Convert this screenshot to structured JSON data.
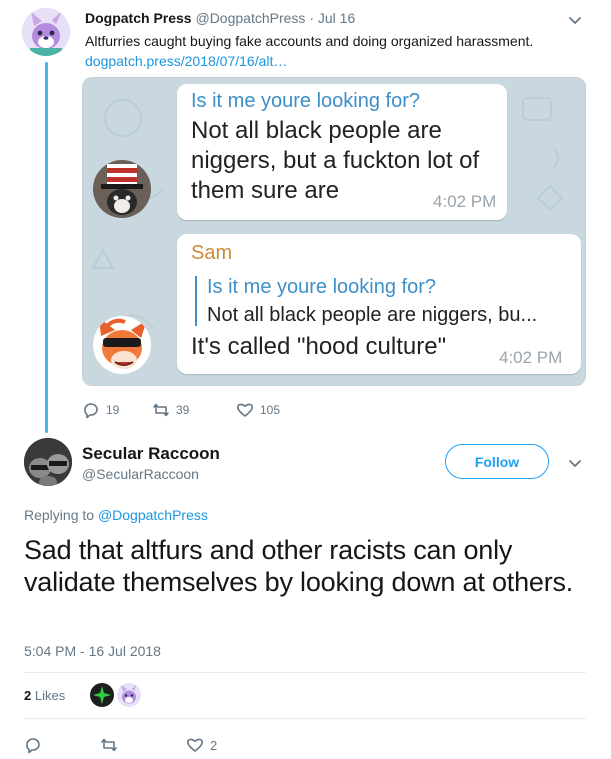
{
  "parent_tweet": {
    "author_name": "Dogpatch Press",
    "author_handle": "@DogpatchPress",
    "separator": "·",
    "date": "Jul 16",
    "text": "Altfurries caught buying fake accounts and doing organized harassment.",
    "link": "dogpatch.press/2018/07/16/alt…",
    "screenshot": {
      "message_1": {
        "quote_title": "Is it me youre looking for?",
        "lines": [
          "Not all black people are",
          "niggers, but a fuckton lot of",
          "them sure are"
        ],
        "time": "4:02 PM"
      },
      "message_2": {
        "sender": "Sam",
        "quote_title": "Is it me youre looking for?",
        "quote_text": "Not all black people are niggers, bu...",
        "text": "It's called \"hood culture\"",
        "time": "4:02 PM"
      }
    },
    "actions": {
      "replies": "19",
      "retweets": "39",
      "likes": "105"
    }
  },
  "focused_tweet": {
    "author_name": "Secular Raccoon",
    "author_handle": "@SecularRaccoon",
    "follow_label": "Follow",
    "replying_prefix": "Replying to",
    "replying_to": "@DogpatchPress",
    "text": "Sad that altfurs and other racists can only validate themselves by looking down at others.",
    "timestamp": "5:04 PM - 16 Jul 2018",
    "likes_count": "2",
    "likes_label": "Likes",
    "actions": {
      "likes": "2"
    }
  },
  "icons": [
    "chevron-down-icon",
    "reply-icon",
    "retweet-icon",
    "like-icon"
  ],
  "colors": {
    "accent": "#1da1f2",
    "link": "#1b95e0",
    "thread_line": "#4ab3f4",
    "muted_text": "#657786",
    "chat_sender": "#d08a36",
    "chat_quote": "#3d8fc9"
  }
}
